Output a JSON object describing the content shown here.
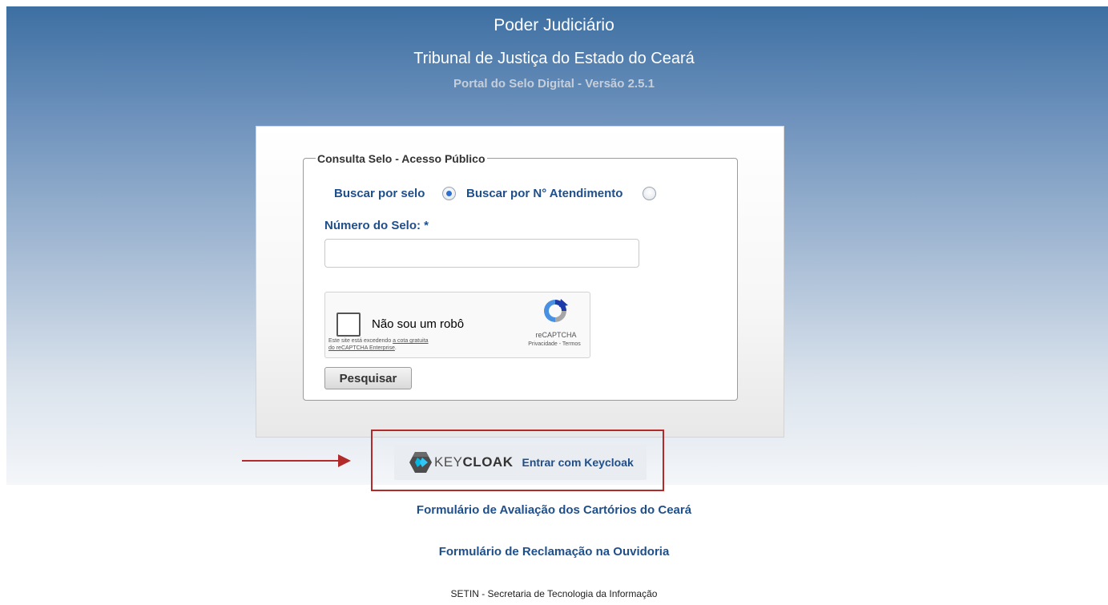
{
  "header": {
    "line1": "Poder Judiciário",
    "line2": "Tribunal de Justiça do Estado do Ceará",
    "line3": "Portal do Selo Digital - Versão 2.5.1"
  },
  "form": {
    "legend": "Consulta Selo - Acesso Público",
    "radio_selo_label": "Buscar por selo",
    "radio_atendimento_label": "Buscar por N° Atendimento",
    "selected": "selo",
    "field_label": "Número do Selo: *",
    "field_value": "",
    "search_button": "Pesquisar"
  },
  "recaptcha": {
    "label": "Não sou um robô",
    "brand": "reCAPTCHA",
    "links": "Privacidade - Termos",
    "note_prefix": "Este site está excedendo ",
    "note_link1": "a cota gratuita",
    "note_link2": "do reCAPTCHA Enterprise",
    "note_suffix": "."
  },
  "keycloak": {
    "brand_prefix": "KEY",
    "brand_suffix": "CLOAK",
    "button_text": "Entrar com Keycloak"
  },
  "links": {
    "avaliacao": "Formulário de Avaliação dos Cartórios do Ceará",
    "ouvidoria": "Formulário de Reclamação na Ouvidoria"
  },
  "footer": "SETIN - Secretaria de Tecnologia da Informação",
  "colors": {
    "accent_red": "#b22a2a",
    "link_blue": "#1f4f8b",
    "radio_blue": "#2c6fd1"
  }
}
